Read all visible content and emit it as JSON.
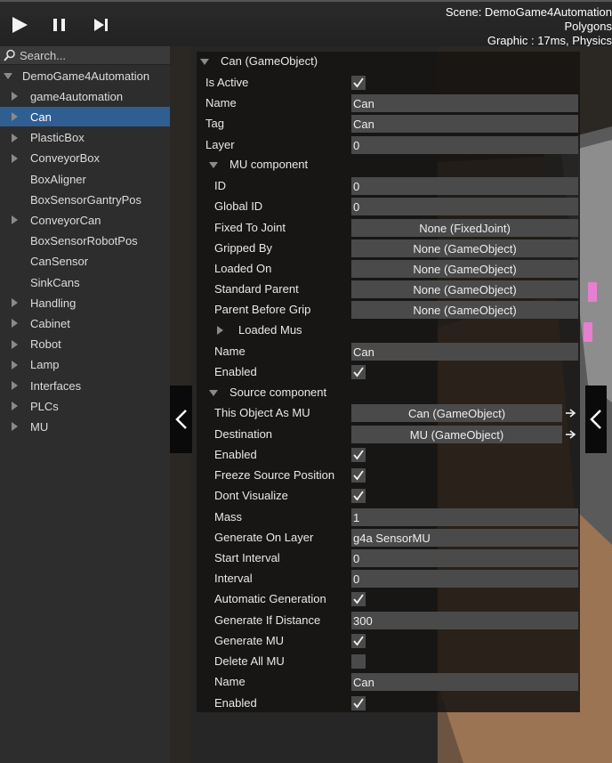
{
  "toolbar": {
    "play_icon": "play-icon",
    "pause_icon": "pause-icon",
    "step_icon": "step-forward-icon"
  },
  "stats": {
    "line1": "Scene: DemoGame4Automation",
    "line2": "Polygons",
    "line3": "Graphic : 17ms, Physics"
  },
  "hierarchy": {
    "search_placeholder": "Search...",
    "items": [
      {
        "label": "DemoGame4Automation",
        "indent": 0,
        "expander": "down",
        "selected": false
      },
      {
        "label": "game4automation",
        "indent": 1,
        "expander": "right",
        "selected": false
      },
      {
        "label": "Can",
        "indent": 1,
        "expander": "right",
        "selected": true
      },
      {
        "label": "PlasticBox",
        "indent": 1,
        "expander": "right",
        "selected": false
      },
      {
        "label": "ConveyorBox",
        "indent": 1,
        "expander": "right",
        "selected": false
      },
      {
        "label": "BoxAligner",
        "indent": 1,
        "expander": "none",
        "selected": false
      },
      {
        "label": "BoxSensorGantryPos",
        "indent": 1,
        "expander": "none",
        "selected": false
      },
      {
        "label": "ConveyorCan",
        "indent": 1,
        "expander": "right",
        "selected": false
      },
      {
        "label": "BoxSensorRobotPos",
        "indent": 1,
        "expander": "none",
        "selected": false
      },
      {
        "label": "CanSensor",
        "indent": 1,
        "expander": "none",
        "selected": false
      },
      {
        "label": "SinkCans",
        "indent": 1,
        "expander": "none",
        "selected": false
      },
      {
        "label": "Handling",
        "indent": 1,
        "expander": "right",
        "selected": false
      },
      {
        "label": "Cabinet",
        "indent": 1,
        "expander": "right",
        "selected": false
      },
      {
        "label": "Robot",
        "indent": 1,
        "expander": "right",
        "selected": false
      },
      {
        "label": "Lamp",
        "indent": 1,
        "expander": "right",
        "selected": false
      },
      {
        "label": "Interfaces",
        "indent": 1,
        "expander": "right",
        "selected": false
      },
      {
        "label": "PLCs",
        "indent": 1,
        "expander": "right",
        "selected": false
      },
      {
        "label": "MU",
        "indent": 1,
        "expander": "right",
        "selected": false
      }
    ]
  },
  "inspector": {
    "rows": [
      {
        "label": "Can (GameObject)",
        "type": "section",
        "indent": 0
      },
      {
        "label": "Is  Active",
        "type": "check",
        "checked": true,
        "indent": 0
      },
      {
        "label": "Name",
        "type": "text",
        "value": "Can",
        "indent": 0
      },
      {
        "label": "Tag",
        "type": "text",
        "value": "Can",
        "indent": 0
      },
      {
        "label": "Layer",
        "type": "text",
        "value": "0",
        "indent": 0
      },
      {
        "label": "MU component",
        "type": "section",
        "indent": 1
      },
      {
        "label": "ID",
        "type": "text",
        "value": "0",
        "indent": 1
      },
      {
        "label": "Global ID",
        "type": "text",
        "value": "0",
        "indent": 1
      },
      {
        "label": "Fixed To Joint",
        "type": "object",
        "value": "None (FixedJoint)",
        "indent": 1
      },
      {
        "label": "Gripped By",
        "type": "object",
        "value": "None (GameObject)",
        "indent": 1
      },
      {
        "label": "Loaded On",
        "type": "object",
        "value": "None (GameObject)",
        "indent": 1
      },
      {
        "label": "Standard Parent",
        "type": "object",
        "value": "None (GameObject)",
        "indent": 1
      },
      {
        "label": "Parent Before Grip",
        "type": "object",
        "value": "None (GameObject)",
        "indent": 1
      },
      {
        "label": "Loaded Mus",
        "type": "collapsed",
        "indent": 2
      },
      {
        "label": "Name",
        "type": "text",
        "value": "Can",
        "indent": 1
      },
      {
        "label": "Enabled",
        "type": "check",
        "checked": true,
        "indent": 1
      },
      {
        "label": "Source component",
        "type": "section",
        "indent": 1
      },
      {
        "label": "This Object As MU",
        "type": "object-link",
        "value": "Can (GameObject)",
        "indent": 1
      },
      {
        "label": "Destination",
        "type": "object-link",
        "value": "MU (GameObject)",
        "indent": 1
      },
      {
        "label": "Enabled",
        "type": "check",
        "checked": true,
        "indent": 1
      },
      {
        "label": "Freeze Source Position",
        "type": "check",
        "checked": true,
        "indent": 1
      },
      {
        "label": "Dont Visualize",
        "type": "check",
        "checked": true,
        "indent": 1
      },
      {
        "label": "Mass",
        "type": "text",
        "value": "1",
        "indent": 1
      },
      {
        "label": "Generate On Layer",
        "type": "text",
        "value": "g4a SensorMU",
        "indent": 1
      },
      {
        "label": "Start Interval",
        "type": "text",
        "value": "0",
        "indent": 1
      },
      {
        "label": "Interval",
        "type": "text",
        "value": "0",
        "indent": 1
      },
      {
        "label": "Automatic Generation",
        "type": "check",
        "checked": true,
        "indent": 1
      },
      {
        "label": "Generate If Distance",
        "type": "text",
        "value": "300",
        "indent": 1
      },
      {
        "label": "Generate MU",
        "type": "check",
        "checked": true,
        "indent": 1
      },
      {
        "label": "Delete All MU",
        "type": "check",
        "checked": false,
        "indent": 1
      },
      {
        "label": "Name",
        "type": "text",
        "value": "Can",
        "indent": 1
      },
      {
        "label": "Enabled",
        "type": "check",
        "checked": true,
        "indent": 1
      }
    ]
  },
  "side_buttons": {
    "left_icon": "chevron-left-icon",
    "right_icon": "chevron-left-icon"
  }
}
